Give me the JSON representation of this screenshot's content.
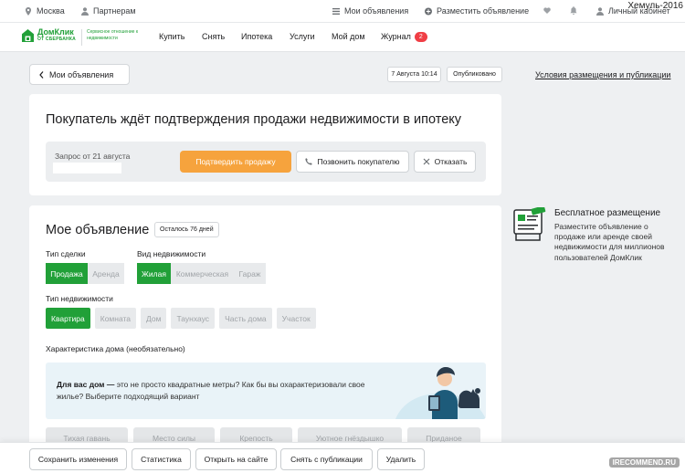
{
  "watermark": "Хемуль-2016",
  "recommend_mark": "IRECOMMEND.RU",
  "topbar": {
    "city": "Москва",
    "partners": "Партнерам",
    "my_ads": "Мои объявления",
    "post_ad": "Разместить объявление",
    "cabinet": "Личный кабинет"
  },
  "nav": {
    "logo_main": "ДомКлик",
    "logo_sub": "ОТ СБЕРБАНКА",
    "tagline": "Сервисное отношение к недвижимости",
    "links": [
      "Купить",
      "Снять",
      "Ипотека",
      "Услуги",
      "Мой дом",
      "Журнал"
    ],
    "journal_badge": "2"
  },
  "header": {
    "back": "Мои объявления",
    "date": "7 Августа 10:14",
    "status": "Опубликовано",
    "conditions_link": "Условия размещения и публикации"
  },
  "request_card": {
    "title": "Покупатель ждёт подтверждения продажи недвижимости в ипотеку",
    "request_label": "Запрос от 21 августа",
    "confirm": "Подтвердить продажу",
    "call": "Позвонить покупателю",
    "decline": "Отказать"
  },
  "ad_card": {
    "title": "Мое объявление",
    "days_left": "Осталось 76 дней",
    "deal_type_label": "Тип сделки",
    "deal_types": [
      "Продажа",
      "Аренда"
    ],
    "deal_selected": "Продажа",
    "property_kind_label": "Вид недвижимости",
    "property_kinds": [
      "Жилая",
      "Коммерческая",
      "Гараж"
    ],
    "kind_selected": "Жилая",
    "property_type_label": "Тип недвижимости",
    "property_types": [
      "Квартира",
      "Комната",
      "Дом",
      "Таунхаус",
      "Часть дома",
      "Участок"
    ],
    "type_selected": "Квартира",
    "characteristic_label": "Характеристика дома (необязательно)",
    "info_bold": "Для вас дом —",
    "info_text": " это не просто квадратные метры? Как бы вы охарактеризовали свое жилье? Выберите подходящий вариант",
    "home_options": [
      "Тихая гавань",
      "Место силы",
      "Крепость",
      "Уютное гнёздышко",
      "Приданое"
    ]
  },
  "sidebar": {
    "title": "Бесплатное размещение",
    "text": "Разместите объявление о продаже или аренде своей недвижимости для миллионов пользователей ДомКлик"
  },
  "bottom_bar": {
    "save": "Сохранить изменения",
    "stats": "Статистика",
    "open": "Открыть на сайте",
    "unpublish": "Снять с публикации",
    "delete": "Удалить"
  },
  "colors": {
    "brand_green": "#21a038",
    "accent_orange": "#f6a33d",
    "badge_red": "#f03e45"
  }
}
